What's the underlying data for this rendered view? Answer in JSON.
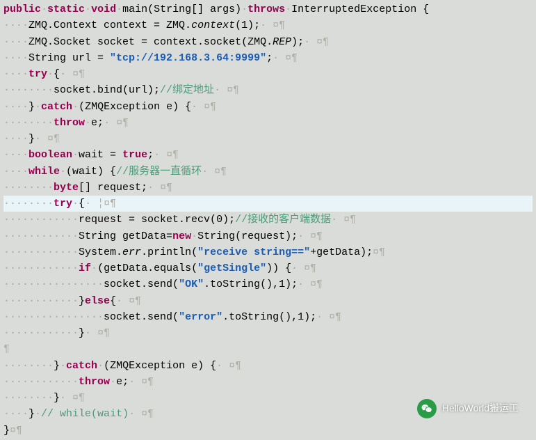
{
  "lines": [
    {
      "hl": false,
      "segs": [
        {
          "c": "kw",
          "t": "public"
        },
        {
          "c": "ws",
          "t": "·"
        },
        {
          "c": "kw",
          "t": "static"
        },
        {
          "c": "ws",
          "t": "·"
        },
        {
          "c": "kw",
          "t": "void"
        },
        {
          "c": "ws",
          "t": "·"
        },
        {
          "c": "ident",
          "t": "main(String[] args)"
        },
        {
          "c": "ws",
          "t": "·"
        },
        {
          "c": "kw",
          "t": "throws"
        },
        {
          "c": "ws",
          "t": "·"
        },
        {
          "c": "ident",
          "t": "InterruptedException {"
        }
      ]
    },
    {
      "hl": false,
      "segs": [
        {
          "c": "ws",
          "t": "····"
        },
        {
          "c": "ident",
          "t": "ZMQ.Context context = ZMQ."
        },
        {
          "c": "static-member italic",
          "t": "context"
        },
        {
          "c": "ident",
          "t": "(1);"
        },
        {
          "c": "ws",
          "t": "· "
        },
        {
          "c": "marker",
          "t": "¤¶"
        }
      ]
    },
    {
      "hl": false,
      "segs": [
        {
          "c": "ws",
          "t": "····"
        },
        {
          "c": "ident",
          "t": "ZMQ.Socket socket = context.socket(ZMQ."
        },
        {
          "c": "static-member italic",
          "t": "REP"
        },
        {
          "c": "ident",
          "t": ");"
        },
        {
          "c": "ws",
          "t": "· "
        },
        {
          "c": "marker",
          "t": "¤¶"
        }
      ]
    },
    {
      "hl": false,
      "segs": [
        {
          "c": "ws",
          "t": "····"
        },
        {
          "c": "ident",
          "t": "String url = "
        },
        {
          "c": "str",
          "t": "\"tcp://192.168.3.64:9999\""
        },
        {
          "c": "ident",
          "t": ";"
        },
        {
          "c": "ws",
          "t": "· "
        },
        {
          "c": "marker",
          "t": "¤¶"
        }
      ]
    },
    {
      "hl": false,
      "segs": [
        {
          "c": "ws",
          "t": "····"
        },
        {
          "c": "kw2",
          "t": "try"
        },
        {
          "c": "ws",
          "t": "·"
        },
        {
          "c": "ident",
          "t": "{"
        },
        {
          "c": "ws",
          "t": "· "
        },
        {
          "c": "marker",
          "t": "¤¶"
        }
      ]
    },
    {
      "hl": false,
      "segs": [
        {
          "c": "ws",
          "t": "········"
        },
        {
          "c": "ident",
          "t": "socket.bind(url);"
        },
        {
          "c": "comment",
          "t": "//绑定地址"
        },
        {
          "c": "ws",
          "t": "· "
        },
        {
          "c": "marker",
          "t": "¤¶"
        }
      ]
    },
    {
      "hl": false,
      "segs": [
        {
          "c": "ws",
          "t": "····"
        },
        {
          "c": "ident",
          "t": "}"
        },
        {
          "c": "ws",
          "t": "·"
        },
        {
          "c": "kw2",
          "t": "catch"
        },
        {
          "c": "ws",
          "t": "·"
        },
        {
          "c": "ident",
          "t": "(ZMQException e) {"
        },
        {
          "c": "ws",
          "t": "· "
        },
        {
          "c": "marker",
          "t": "¤¶"
        }
      ]
    },
    {
      "hl": false,
      "segs": [
        {
          "c": "ws",
          "t": "········"
        },
        {
          "c": "kw2",
          "t": "throw"
        },
        {
          "c": "ws",
          "t": "·"
        },
        {
          "c": "ident",
          "t": "e;"
        },
        {
          "c": "ws",
          "t": "· "
        },
        {
          "c": "marker",
          "t": "¤¶"
        }
      ]
    },
    {
      "hl": false,
      "segs": [
        {
          "c": "ws",
          "t": "····"
        },
        {
          "c": "ident",
          "t": "}"
        },
        {
          "c": "ws",
          "t": "· "
        },
        {
          "c": "marker",
          "t": "¤¶"
        }
      ]
    },
    {
      "hl": false,
      "segs": [
        {
          "c": "ws",
          "t": "····"
        },
        {
          "c": "kw2",
          "t": "boolean"
        },
        {
          "c": "ws",
          "t": "·"
        },
        {
          "c": "ident",
          "t": "wait = "
        },
        {
          "c": "kw2",
          "t": "true"
        },
        {
          "c": "ident",
          "t": ";"
        },
        {
          "c": "ws",
          "t": "· "
        },
        {
          "c": "marker",
          "t": "¤¶"
        }
      ]
    },
    {
      "hl": false,
      "segs": [
        {
          "c": "ws",
          "t": "····"
        },
        {
          "c": "kw2",
          "t": "while"
        },
        {
          "c": "ws",
          "t": "·"
        },
        {
          "c": "ident",
          "t": "(wait) {"
        },
        {
          "c": "comment",
          "t": "//服务器一直循环"
        },
        {
          "c": "ws",
          "t": "· "
        },
        {
          "c": "marker",
          "t": "¤¶"
        }
      ]
    },
    {
      "hl": false,
      "segs": [
        {
          "c": "ws",
          "t": "········"
        },
        {
          "c": "kw2",
          "t": "byte"
        },
        {
          "c": "ident",
          "t": "[] request;"
        },
        {
          "c": "ws",
          "t": "· "
        },
        {
          "c": "marker",
          "t": "¤¶"
        }
      ]
    },
    {
      "hl": true,
      "segs": [
        {
          "c": "ws",
          "t": "········"
        },
        {
          "c": "kw2",
          "t": "try"
        },
        {
          "c": "ws",
          "t": "·"
        },
        {
          "c": "ident",
          "t": "{"
        },
        {
          "c": "ws",
          "t": "· "
        },
        {
          "c": "marker",
          "t": "¦¤¶"
        }
      ]
    },
    {
      "hl": false,
      "segs": [
        {
          "c": "ws",
          "t": "············"
        },
        {
          "c": "ident",
          "t": "request = socket.recv(0);"
        },
        {
          "c": "comment",
          "t": "//接收的客户端数据"
        },
        {
          "c": "ws",
          "t": "· "
        },
        {
          "c": "marker",
          "t": "¤¶"
        }
      ]
    },
    {
      "hl": false,
      "segs": [
        {
          "c": "ws",
          "t": "············"
        },
        {
          "c": "ident",
          "t": "String getData="
        },
        {
          "c": "kw2",
          "t": "new"
        },
        {
          "c": "ws",
          "t": "·"
        },
        {
          "c": "ident",
          "t": "String(request);"
        },
        {
          "c": "ws",
          "t": "· "
        },
        {
          "c": "marker",
          "t": "¤¶"
        }
      ]
    },
    {
      "hl": false,
      "segs": [
        {
          "c": "ws",
          "t": "············"
        },
        {
          "c": "ident",
          "t": "System."
        },
        {
          "c": "static-member italic",
          "t": "err"
        },
        {
          "c": "ident",
          "t": ".println("
        },
        {
          "c": "str",
          "t": "\"receive string==\""
        },
        {
          "c": "ident",
          "t": "+getData);"
        },
        {
          "c": "marker",
          "t": "¤¶"
        }
      ]
    },
    {
      "hl": false,
      "segs": [
        {
          "c": "ws",
          "t": "············"
        },
        {
          "c": "kw2",
          "t": "if"
        },
        {
          "c": "ws",
          "t": "·"
        },
        {
          "c": "ident",
          "t": "(getData.equals("
        },
        {
          "c": "str",
          "t": "\"getSingle\""
        },
        {
          "c": "ident",
          "t": ")) {"
        },
        {
          "c": "ws",
          "t": "· "
        },
        {
          "c": "marker",
          "t": "¤¶"
        }
      ]
    },
    {
      "hl": false,
      "segs": [
        {
          "c": "ws",
          "t": "················"
        },
        {
          "c": "ident",
          "t": "socket.send("
        },
        {
          "c": "str",
          "t": "\"OK\""
        },
        {
          "c": "ident",
          "t": ".toString(),1);"
        },
        {
          "c": "ws",
          "t": "· "
        },
        {
          "c": "marker",
          "t": "¤¶"
        }
      ]
    },
    {
      "hl": false,
      "segs": [
        {
          "c": "ws",
          "t": "············"
        },
        {
          "c": "ident",
          "t": "}"
        },
        {
          "c": "kw2",
          "t": "else"
        },
        {
          "c": "ident",
          "t": "{"
        },
        {
          "c": "ws",
          "t": "· "
        },
        {
          "c": "marker",
          "t": "¤¶"
        }
      ]
    },
    {
      "hl": false,
      "segs": [
        {
          "c": "ws",
          "t": "················"
        },
        {
          "c": "ident",
          "t": "socket.send("
        },
        {
          "c": "str",
          "t": "\"error\""
        },
        {
          "c": "ident",
          "t": ".toString(),1);"
        },
        {
          "c": "ws",
          "t": "· "
        },
        {
          "c": "marker",
          "t": "¤¶"
        }
      ]
    },
    {
      "hl": false,
      "segs": [
        {
          "c": "ws",
          "t": "············"
        },
        {
          "c": "ident",
          "t": "}"
        },
        {
          "c": "ws",
          "t": "· "
        },
        {
          "c": "marker",
          "t": "¤¶"
        }
      ]
    },
    {
      "hl": false,
      "segs": [
        {
          "c": "marker",
          "t": "¶"
        }
      ]
    },
    {
      "hl": false,
      "segs": [
        {
          "c": "ws",
          "t": "········"
        },
        {
          "c": "ident",
          "t": "}"
        },
        {
          "c": "ws",
          "t": "·"
        },
        {
          "c": "kw2",
          "t": "catch"
        },
        {
          "c": "ws",
          "t": "·"
        },
        {
          "c": "ident",
          "t": "(ZMQException e) {"
        },
        {
          "c": "ws",
          "t": "· "
        },
        {
          "c": "marker",
          "t": "¤¶"
        }
      ]
    },
    {
      "hl": false,
      "segs": [
        {
          "c": "ws",
          "t": "············"
        },
        {
          "c": "kw2",
          "t": "throw"
        },
        {
          "c": "ws",
          "t": "·"
        },
        {
          "c": "ident",
          "t": "e;"
        },
        {
          "c": "ws",
          "t": "· "
        },
        {
          "c": "marker",
          "t": "¤¶"
        }
      ]
    },
    {
      "hl": false,
      "segs": [
        {
          "c": "ws",
          "t": "········"
        },
        {
          "c": "ident",
          "t": "}"
        },
        {
          "c": "ws",
          "t": "· "
        },
        {
          "c": "marker",
          "t": "¤¶"
        }
      ]
    },
    {
      "hl": false,
      "segs": [
        {
          "c": "ws",
          "t": "····"
        },
        {
          "c": "ident",
          "t": "}"
        },
        {
          "c": "ws",
          "t": "·"
        },
        {
          "c": "comment",
          "t": "// while(wait)"
        },
        {
          "c": "ws",
          "t": "· "
        },
        {
          "c": "marker",
          "t": "¤¶"
        }
      ]
    },
    {
      "hl": false,
      "segs": [
        {
          "c": "ident",
          "t": "}"
        },
        {
          "c": "marker",
          "t": "¤¶"
        }
      ]
    }
  ],
  "watermark": {
    "text": "HelloWorld搬运工"
  }
}
